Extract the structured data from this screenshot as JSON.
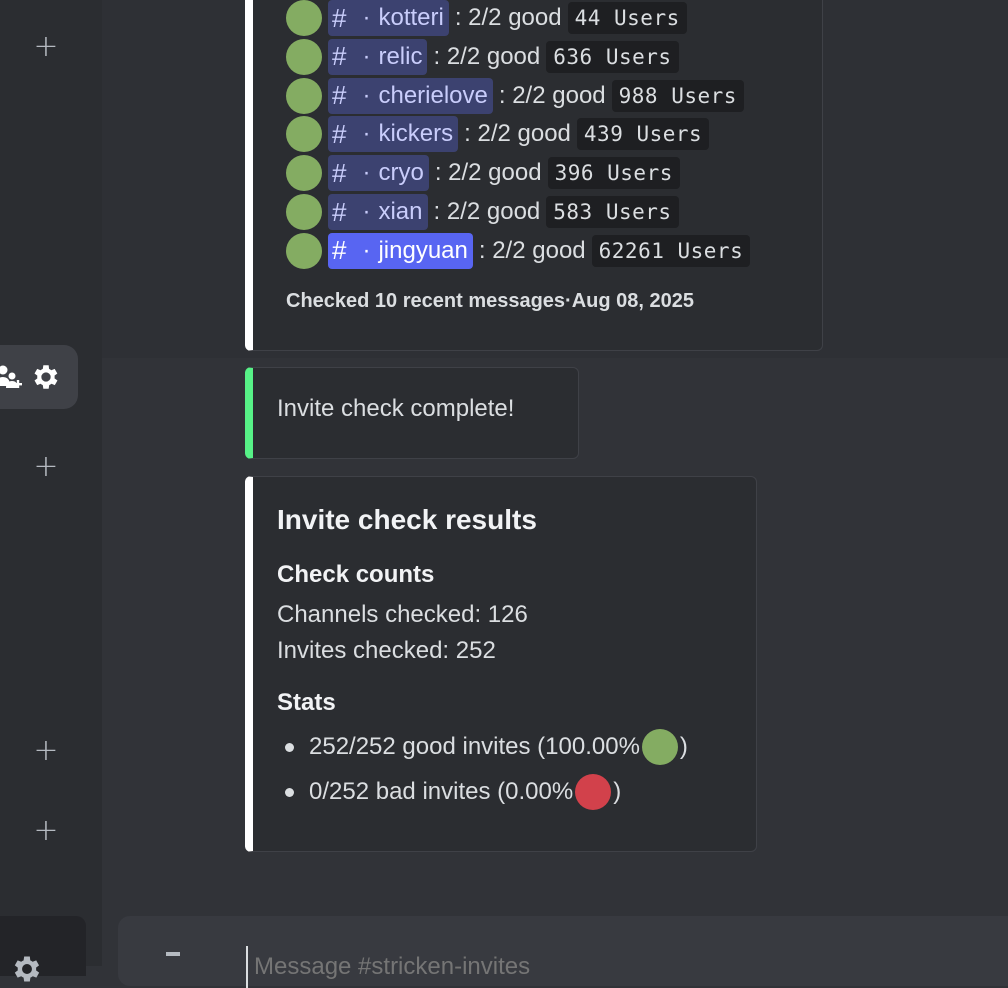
{
  "colors": {
    "good": "#84ac62",
    "bad": "#d2414b",
    "mention_bg": "#3c4270",
    "mention_active_bg": "#5865f2",
    "success_bar": "#57f287"
  },
  "sidebar": {
    "add_icon": "plus-icon",
    "active_server_icons": [
      "people-add-icon",
      "gear-icon"
    ],
    "bottom_icon": "gear-icon"
  },
  "invite_list": [
    {
      "channel": "kotteri",
      "status": ": 2/2 good",
      "users": "44 Users"
    },
    {
      "channel": "relic",
      "status": ": 2/2 good",
      "users": "636 Users"
    },
    {
      "channel": "cherielove",
      "status": ": 2/2 good",
      "users": "988 Users"
    },
    {
      "channel": "kickers",
      "status": ": 2/2 good",
      "users": "439 Users"
    },
    {
      "channel": "cryo",
      "status": ": 2/2 good",
      "users": "396 Users"
    },
    {
      "channel": "xian",
      "status": ": 2/2 good",
      "users": "583 Users"
    },
    {
      "channel": "jingyuan",
      "status": ": 2/2 good",
      "users": "62261 Users"
    }
  ],
  "channel_prefix": "#",
  "channel_sep": "·",
  "list_footer": "Checked 10 recent messages·Aug 08, 2025",
  "complete_embed": {
    "text": "Invite check complete!"
  },
  "results_embed": {
    "title": "Invite check results",
    "counts_heading": "Check counts",
    "channels_checked": "Channels checked: 126",
    "invites_checked": "Invites checked: 252",
    "stats_heading": "Stats",
    "good_line": "252/252 good invites (100.00%",
    "bad_line": "0/252 bad invites (0.00%",
    "close_paren": ")"
  },
  "composer": {
    "placeholder": "Message #stricken-invites"
  }
}
